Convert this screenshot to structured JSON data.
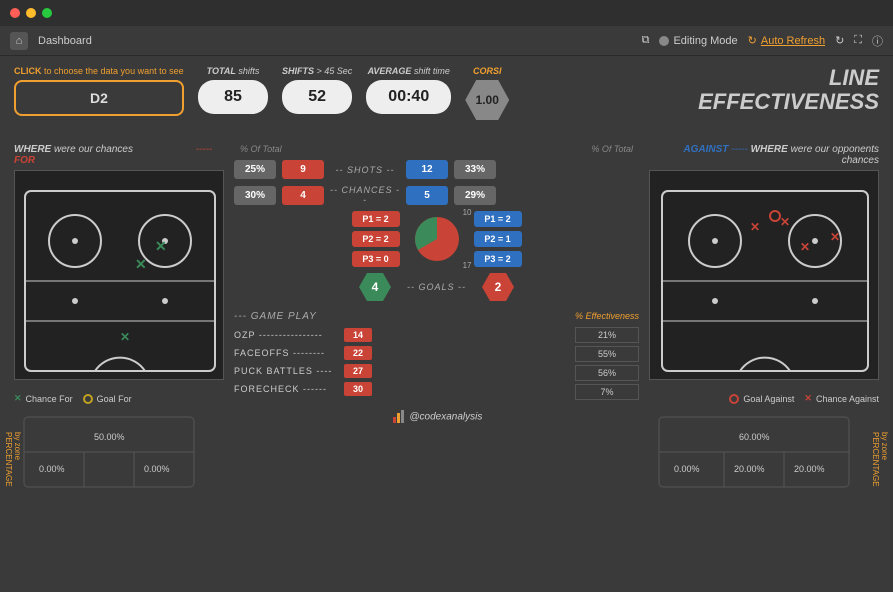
{
  "header": {
    "page": "Dashboard",
    "editing": "Editing Mode",
    "refresh": "Auto Refresh"
  },
  "selector": {
    "hint_pre": "CLICK",
    "hint_post": " to choose the data you want to see",
    "value": "D2"
  },
  "stats": {
    "total_lbl_b": "TOTAL",
    "total_lbl": " shifts",
    "total": "85",
    "shifts_lbl_b": "SHIFTS",
    "shifts_lbl": " > 45 Sec",
    "shifts": "52",
    "avg_lbl_b": "AVERAGE",
    "avg_lbl": " shift time",
    "avg": "00:40",
    "corsi_lbl": "CORSI",
    "corsi": "1.00"
  },
  "title": {
    "l1": "LINE",
    "l2": "EFFECTIVENESS"
  },
  "for": {
    "where_lbl": "WHERE",
    "were": " were our chances",
    "dashes": "-----",
    "word": "FOR"
  },
  "against": {
    "word": "AGAINST",
    "dashes": "-----",
    "where_lbl": "WHERE",
    "were": " were our opponents chances"
  },
  "pct_of_total": "% Of Total",
  "comparison": {
    "shots": {
      "label": "-- SHOTS --",
      "for_pct": "25%",
      "for_val": "9",
      "ag_val": "12",
      "ag_pct": "33%"
    },
    "chances": {
      "label": "-- CHANCES --",
      "for_pct": "30%",
      "for_val": "4",
      "ag_val": "5",
      "ag_pct": "29%"
    }
  },
  "periods": {
    "for": [
      "P1 = 2",
      "P2 = 2",
      "P3 = 0"
    ],
    "against": [
      "P1 = 2",
      "P2 = 1",
      "P3 = 2"
    ]
  },
  "chart_data": {
    "type": "pie",
    "series": [
      {
        "name": "For goals share",
        "value": 10,
        "color": "#3a8a5a"
      },
      {
        "name": "Against goals share",
        "value": 17,
        "color": "#c94436"
      }
    ],
    "labels": {
      "top": "10",
      "bottom": "17"
    }
  },
  "goals": {
    "for": "4",
    "label": "-- GOALS --",
    "against": "2"
  },
  "gameplay": {
    "title": "--- GAME PLAY",
    "rows": [
      {
        "name": "OZP ----------------",
        "val": "14"
      },
      {
        "name": "FACEOFFS --------",
        "val": "22"
      },
      {
        "name": "PUCK BATTLES ----",
        "val": "27"
      },
      {
        "name": "FORECHECK ------",
        "val": "30"
      }
    ]
  },
  "effectiveness": {
    "title": "% Effectiveness",
    "vals": [
      "21%",
      "55%",
      "56%",
      "7%"
    ]
  },
  "legend_for": {
    "chance": "Chance For",
    "goal": "Goal For"
  },
  "legend_against": {
    "goal": "Goal Against",
    "chance": "Chance Against"
  },
  "zone_pct_for": {
    "top": "50.00%",
    "bl": "0.00%",
    "br": "0.00%"
  },
  "zone_pct_against": {
    "top": "60.00%",
    "bl": "0.00%",
    "bm": "20.00%",
    "br": "20.00%"
  },
  "pct_by_zone": "PERCENTAGE by zone",
  "footer": "@codexanalysis"
}
